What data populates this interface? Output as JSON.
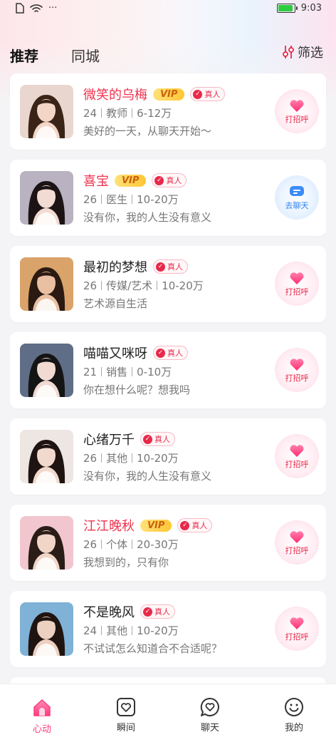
{
  "status_bar": {
    "time": "9:03",
    "dots": "···"
  },
  "header": {
    "tabs": [
      {
        "label": "推荐"
      },
      {
        "label": "同城"
      }
    ],
    "filter_label": "筛选"
  },
  "badges": {
    "vip": "VIP",
    "real": "真人"
  },
  "actions": {
    "greet": "打招呼",
    "chat": "去聊天"
  },
  "profiles": [
    {
      "name": "微笑的乌梅",
      "vip": true,
      "age": "24",
      "job": "教师",
      "income": "6-12万",
      "bio": "美好的一天，从聊天开始～",
      "action": "greet",
      "hair": "#3a2418",
      "skin": "#f3d6c6",
      "bg": "#e9d7cf"
    },
    {
      "name": "喜宝",
      "vip": true,
      "age": "26",
      "job": "医生",
      "income": "10-20万",
      "bio": "没有你，我的人生没有意义",
      "action": "chat",
      "hair": "#1c1414",
      "skin": "#f2dbd2",
      "bg": "#b9b2c0"
    },
    {
      "name": "最初的梦想",
      "vip": false,
      "age": "26",
      "job": "传媒/艺术",
      "income": "10-20万",
      "bio": "艺术源自生活",
      "action": "greet",
      "hair": "#2b1a12",
      "skin": "#eac0a2",
      "bg": "#d9a36a"
    },
    {
      "name": "喵喵又咪呀",
      "vip": false,
      "age": "21",
      "job": "销售",
      "income": "0-10万",
      "bio": "你在想什么呢？想我吗",
      "action": "greet",
      "hair": "#141414",
      "skin": "#f0dad2",
      "bg": "#5f6e86"
    },
    {
      "name": "心绪万千",
      "vip": false,
      "age": "26",
      "job": "其他",
      "income": "10-20万",
      "bio": "没有你，我的人生没有意义",
      "action": "greet",
      "hair": "#1e1412",
      "skin": "#f2d9cd",
      "bg": "#ede6e3"
    },
    {
      "name": "江江晚秋",
      "vip": true,
      "age": "26",
      "job": "个体",
      "income": "20-30万",
      "bio": "我想到的，只有你",
      "action": "greet",
      "hair": "#2a1c16",
      "skin": "#f1d6c8",
      "bg": "#f2c6cf"
    },
    {
      "name": "不是晚风",
      "vip": false,
      "age": "24",
      "job": "其他",
      "income": "10-20万",
      "bio": "不试试怎么知道合不合适呢？",
      "action": "greet",
      "hair": "#201410",
      "skin": "#ecd0c0",
      "bg": "#7fb2d6"
    }
  ],
  "nav": [
    {
      "label": "心动",
      "icon": "home-icon",
      "active": true
    },
    {
      "label": "瞬间",
      "icon": "moments-heart-icon",
      "active": false
    },
    {
      "label": "聊天",
      "icon": "chat-heart-icon",
      "active": false
    },
    {
      "label": "我的",
      "icon": "smile-icon",
      "active": false
    }
  ],
  "colors": {
    "accent": "#ff3a7f",
    "vip_name": "#f0324e",
    "chat_blue": "#2f7ff0"
  }
}
